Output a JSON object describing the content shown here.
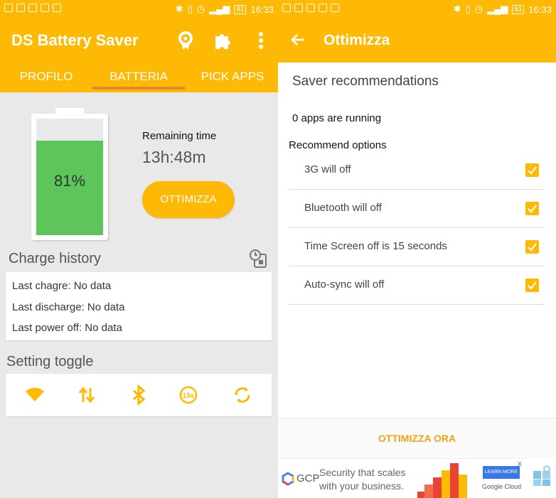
{
  "status_bar": {
    "time": "16:33",
    "battery": "81"
  },
  "left": {
    "app_title": "DS Battery Saver",
    "tabs": [
      "PROFILO",
      "BATTERIA",
      "PICK APPS"
    ],
    "battery": {
      "percent_label": "81%",
      "level": 0.81
    },
    "remaining_label": "Remaining time",
    "remaining_time": "13h:48m",
    "optimize_button": "OTTIMIZZA",
    "charge_history": {
      "title": "Charge history",
      "lines": [
        "Last chagre: No data",
        "Last discharge: No data",
        "Last power off: No data"
      ]
    },
    "setting_toggle": {
      "title": "Setting toggle",
      "icons": [
        "wifi-icon",
        "data-transfer-icon",
        "bluetooth-icon",
        "timeout-15s-icon",
        "sync-icon"
      ]
    }
  },
  "right": {
    "title": "Ottimizza",
    "saver_title": "Saver recommendations",
    "apps_running": "0 apps are running",
    "recommend_title": "Recommend options",
    "options": [
      {
        "label": "3G will off",
        "checked": true
      },
      {
        "label": "Bluetooth will off",
        "checked": true
      },
      {
        "label": "Time Screen off is 15 seconds",
        "checked": true
      },
      {
        "label": "Auto-sync will off",
        "checked": true
      }
    ],
    "optimize_now": "OTTIMIZZA ORA"
  },
  "ad": {
    "brand_short": "GCP",
    "line1": "Security that scales",
    "line2": "with your business.",
    "cta": "LEARN MORE",
    "brand": "Google Cloud",
    "close": "x"
  },
  "colors": {
    "accent": "#fdb904",
    "battery_fill": "#5ec55a",
    "indicator": "#e4892b"
  }
}
